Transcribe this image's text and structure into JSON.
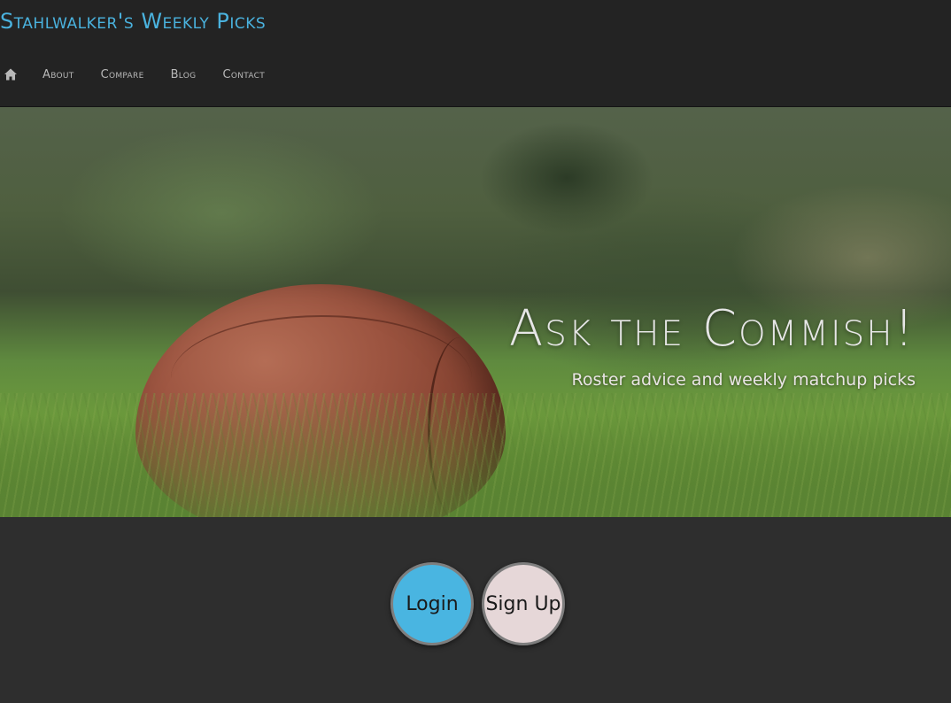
{
  "header": {
    "site_title": "Stahlwalker's Weekly Picks",
    "title_color": "#4ab2de",
    "nav": {
      "home_icon": "home-icon",
      "items": [
        "About",
        "Compare",
        "Blog",
        "Contact"
      ]
    }
  },
  "hero": {
    "headline": "Ask the Commish!",
    "subhead": "Roster advice and weekly matchup picks",
    "image": "football-on-grass"
  },
  "actions": {
    "login_label": "Login",
    "login_color": "#49b5e1",
    "signup_label": "Sign Up",
    "signup_color": "#e6d7d8"
  }
}
